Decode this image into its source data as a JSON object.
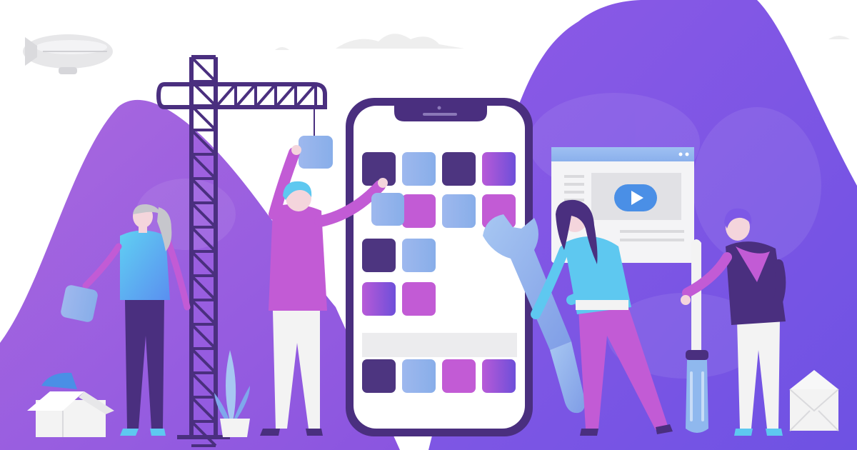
{
  "scene": {
    "kind": "flat illustration: team building a mobile app",
    "icons": [
      "blimp-icon",
      "crane-icon",
      "smartphone-icon",
      "wrench-icon",
      "screwdriver-icon",
      "video-player-window-icon",
      "play-icon",
      "open-box-icon",
      "envelope-icon",
      "plant-icon",
      "cloud-icon"
    ],
    "colors": {
      "background": "#ffffff",
      "mountain_left": "#9c5fe0",
      "mountain_right": "#7d58e6",
      "phone_frame": "#4a2f7f",
      "tile_dark": "#4d3580",
      "tile_magenta": "#c25bd5",
      "tile_blue": "#8fb8ee",
      "accent_blue": "#5ec8f0",
      "cloud": "#eeeeee"
    }
  },
  "phone": {
    "tile_rows": [
      [
        "dark",
        "blue",
        "dark",
        "gradient"
      ],
      [
        "",
        "magenta",
        "blue",
        "magenta"
      ],
      [
        "dark",
        "blue",
        "",
        ""
      ],
      [
        "gradient",
        "magenta",
        "",
        ""
      ]
    ],
    "dock_row": [
      "dark",
      "blue",
      "magenta",
      "gradient"
    ]
  }
}
